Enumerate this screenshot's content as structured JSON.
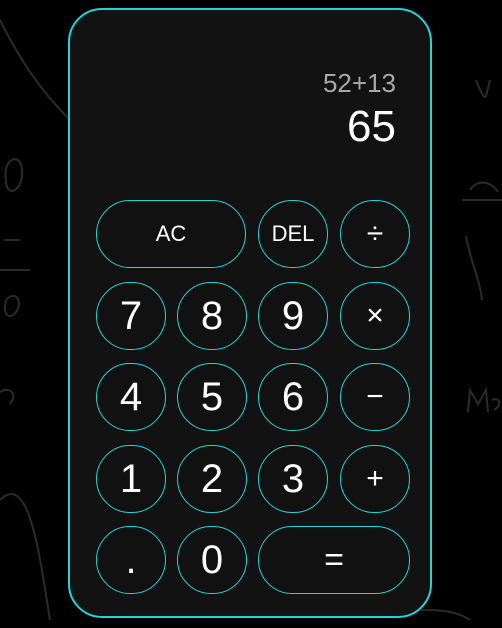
{
  "display": {
    "expression": "52+13",
    "result": "65"
  },
  "keys": {
    "ac": "AC",
    "del": "DEL",
    "divide": "÷",
    "seven": "7",
    "eight": "8",
    "nine": "9",
    "multiply": "×",
    "four": "4",
    "five": "5",
    "six": "6",
    "minus": "−",
    "one": "1",
    "two": "2",
    "three": "3",
    "plus": "+",
    "dot": ".",
    "zero": "0",
    "equals": "="
  },
  "colors": {
    "accent": "#22d3d8",
    "body": "#121212",
    "background": "#000000",
    "expression_text": "#a8a8a8",
    "result_text": "#ffffff"
  }
}
